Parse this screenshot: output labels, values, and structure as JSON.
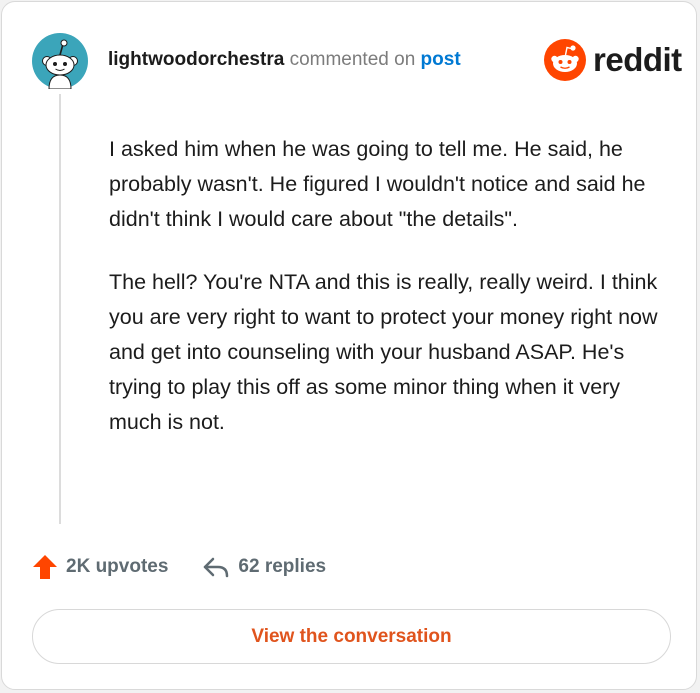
{
  "header": {
    "username": "lightwoodorchestra",
    "action_text": "commented on",
    "post_link": "post",
    "logo_text": "reddit"
  },
  "comment": {
    "paragraphs": [
      "I asked him when he was going to tell me. He said, he probably wasn't. He figured I wouldn't notice and said he didn't think I would care about \"the details\".",
      "The hell? You're NTA and this is really, really weird. I think you are very right to want to protect your money right now and get into counseling with your husband ASAP. He's trying to play this off as some minor thing when it very much is not."
    ]
  },
  "actions": {
    "upvotes_label": "2K upvotes",
    "replies_label": "62 replies"
  },
  "footer": {
    "view_button_label": "View the conversation"
  },
  "colors": {
    "reddit_orange": "#ff4500",
    "link_blue": "#0079d3",
    "button_text": "#e0541d",
    "avatar_bg": "#3ba5ba"
  },
  "icons": {
    "avatar": "snoo-avatar-icon",
    "logo": "reddit-logo-icon",
    "upvote": "upvote-arrow-icon",
    "reply": "reply-arrow-icon"
  }
}
